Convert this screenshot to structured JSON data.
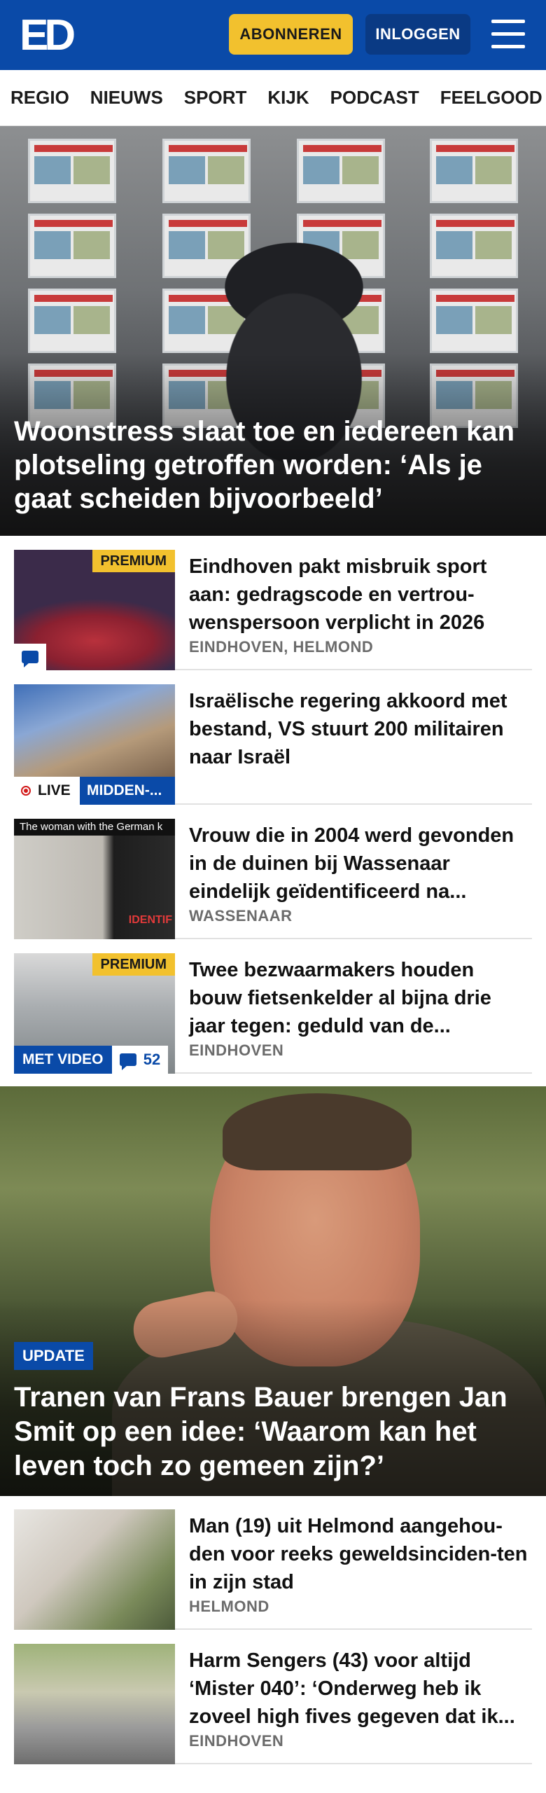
{
  "header": {
    "logo": "ED",
    "subscribe_label": "ABONNEREN",
    "login_label": "INLOGGEN"
  },
  "nav": {
    "items": [
      "REGIO",
      "NIEUWS",
      "SPORT",
      "KIJK",
      "PODCAST",
      "FEELGOOD"
    ]
  },
  "hero": {
    "title": "Woonstress slaat toe en iedereen kan plotseling getroffen worden: ‘Als je gaat scheiden bijvoorbeeld’"
  },
  "articles": [
    {
      "title": "Eindhoven pakt misbruik sport aan: gedragscode en vertrou-wenspersoon verplicht in 2026",
      "place": "EINDHOVEN, HELMOND",
      "badge": "PREMIUM"
    },
    {
      "title": "Israëlische regering akkoord met bestand, VS stuurt 200 militairen naar Israël",
      "live_label": "LIVE",
      "category": "MIDDEN-..."
    },
    {
      "title": "Vrouw die in 2004 werd gevonden in de duinen bij Wassenaar eindelijk geïdentificeerd na...",
      "place": "WASSENAAR",
      "thumb_caption": "The woman with the German k",
      "thumb_caption2": "IDENTIF"
    },
    {
      "title": "Twee bezwaarmakers houden bouw fietsenkelder al bijna drie jaar tegen: geduld van de...",
      "place": "EINDHOVEN",
      "badge": "PREMIUM",
      "video_label": "MET VIDEO",
      "comment_count": "52"
    }
  ],
  "feature": {
    "badge": "UPDATE",
    "title": "Tranen van Frans Bauer brengen Jan Smit op een idee: ‘Waarom kan het leven toch zo gemeen zijn?’"
  },
  "articles_bottom": [
    {
      "title": "Man (19) uit Helmond aangehou-den voor reeks geweldsinciden-ten in zijn stad",
      "place": "HELMOND"
    },
    {
      "title": "Harm Sengers (43) voor altijd ‘Mister 040’: ‘Onderweg heb ik zoveel high fives gegeven dat ik...",
      "place": "EINDHOVEN"
    }
  ],
  "colors": {
    "brand_blue": "#0a4aa8",
    "subscribe_yellow": "#f2c12e"
  }
}
